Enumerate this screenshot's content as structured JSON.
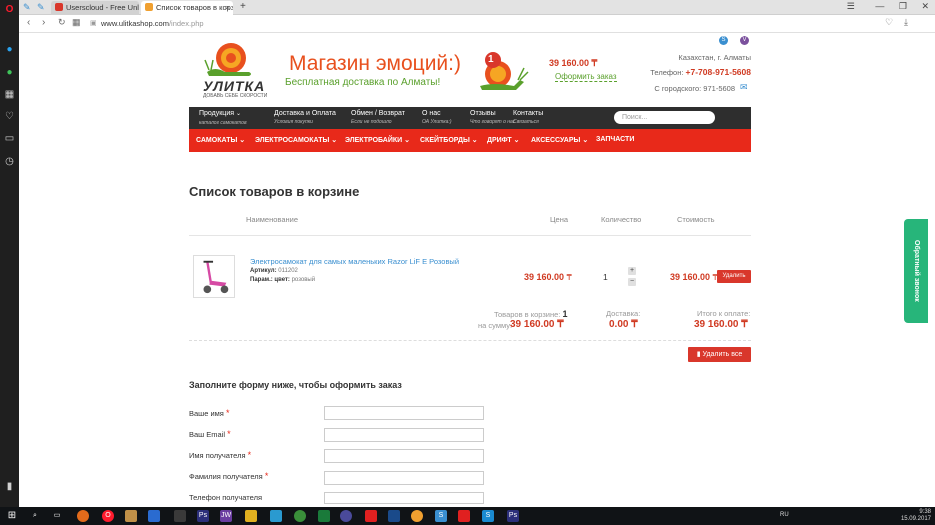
{
  "browser": {
    "tabs": [
      {
        "label": "Userscloud - Free Unlimit",
        "close": "×"
      },
      {
        "label": "Список товаров в корзи",
        "close": "×"
      }
    ],
    "new_tab": "+",
    "url_host": "www.ulitkashop.com",
    "url_path": "/index.php",
    "icons": {
      "back": "back-icon",
      "forward": "forward-icon",
      "reload": "reload-icon",
      "speed_dial": "grid-icon",
      "bookmark": "heart-icon"
    }
  },
  "site": {
    "logo_name": "УЛИТКА",
    "logo_tagline": "ДОБАВЬ СЕБЕ СКОРОСТИ",
    "headline": "Магазин эмоций:)",
    "subhead": "Бесплатная доставка по Алматы!",
    "cart_count": "1",
    "cart_sum": "39 160.00 ₸",
    "checkout_link": "Оформить заказ",
    "city": "Казахстан, г. Алматы",
    "phone_label": "Телефон:",
    "phone": "+7-708-971-5608",
    "landline": "С городского: 971-5608"
  },
  "menu_top": [
    {
      "label": "Продукция",
      "sub": "каталог самокатов"
    },
    {
      "label": "Доставка и Оплата",
      "sub": "Условия покупки"
    },
    {
      "label": "Обмен / Возврат",
      "sub": "Если не подошло"
    },
    {
      "label": "О нас",
      "sub": "ОА Улитка:)"
    },
    {
      "label": "Отзывы",
      "sub": "Что говорят о нас"
    },
    {
      "label": "Контакты",
      "sub": "Связаться"
    }
  ],
  "search_placeholder": "Поиск...",
  "menu_categories": [
    "САМОКАТЫ",
    "ЭЛЕКТРОСАМОКАТЫ",
    "ЭЛЕКТРОБАЙКИ",
    "СКЕЙТБОРДЫ",
    "ДРИФТ",
    "АКСЕССУАРЫ",
    "ЗАПЧАСТИ"
  ],
  "cart": {
    "title": "Список товаров в корзине",
    "columns": {
      "name": "Наименование",
      "price": "Цена",
      "qty": "Количество",
      "total": "Стоимость"
    },
    "item": {
      "name": "Электросамокат для самых маленьких Razor LiF E Розовый",
      "article_label": "Артикул:",
      "article": "011202",
      "param_label": "Парам.: цвет:",
      "param": "розовый",
      "price": "39 160.00",
      "currency": "₸",
      "qty": "1",
      "total": "39 160.00",
      "delete_label": "Удалить"
    },
    "summary": {
      "items_label": "Товаров в корзине:",
      "items_count": "1",
      "sum_label": "на сумму:",
      "sum": "39 160.00 ₸",
      "delivery_label": "Доставка:",
      "delivery": "0.00 ₸",
      "total_label": "Итого к оплате:",
      "total": "39 160.00 ₸"
    },
    "delete_all": "Удалить все"
  },
  "form": {
    "title": "Заполните форму ниже, чтобы оформить заказ",
    "fields": [
      {
        "label": "Ваше имя",
        "required": "*"
      },
      {
        "label": "Ваш Email",
        "required": "*"
      },
      {
        "label": "Имя получателя",
        "required": "*"
      },
      {
        "label": "Фамилия получателя",
        "required": "*"
      },
      {
        "label": "Телефон получателя",
        "required": ""
      }
    ]
  },
  "callback_label": "Обратный звонок",
  "taskbar": {
    "lang": "RU",
    "time": "9:38",
    "date": "15.09.2017"
  },
  "colors": {
    "brand_red": "#e8291a",
    "brand_green": "#5aa02c",
    "price_red": "#d03a22",
    "callback_green": "#27b57a"
  }
}
